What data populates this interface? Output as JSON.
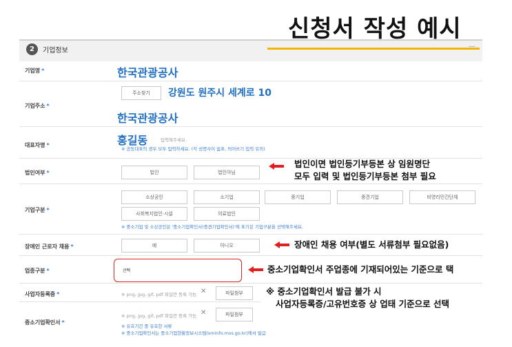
{
  "title": "신청서 작성 예시",
  "section": {
    "number": "2",
    "label": "기업정보",
    "dash": "—"
  },
  "rows": {
    "company_name": {
      "label": "기업명",
      "req": "*",
      "value": "한국관광공사"
    },
    "address": {
      "label": "기업주소",
      "req": "*",
      "search_button": "주소찾기",
      "value": "강원도 원주시 세계로 10"
    },
    "address_org": {
      "value": "한국관광공사"
    },
    "ceo": {
      "label": "대표자명",
      "req": "*",
      "value": "홍길동",
      "placeholder": "입력해주세요.",
      "hint": "※ 공동대표의 경우 모두 입력하세요. (각 성명사이 쉼표, 띄어쓰기 입력 유의)"
    },
    "corp": {
      "label": "법인여부",
      "req": "*",
      "options": [
        "법인",
        "법인아님"
      ]
    },
    "type": {
      "label": "기업구분",
      "req": "*",
      "options_row1": [
        "소상공인",
        "소기업",
        "중기업",
        "중견기업",
        "비영리민간단체"
      ],
      "options_row2": [
        "사회복지법인·시설",
        "의료법인"
      ],
      "hint": "※ 중소기업 및 소상공인은 '중소기업확인서(중견기업확인서)'에 표기된 기업구분을 선택해주세요."
    },
    "disabled": {
      "label": "장애인 근로자 채용",
      "req": "*",
      "options": [
        "예",
        "아니오"
      ]
    },
    "industry": {
      "label": "업종구분",
      "req": "*",
      "select_value": "선택"
    },
    "bizreg": {
      "label": "사업자등록증",
      "req": "*",
      "file_hint": "※ png, jpg, gif, pdf 파일만 등록 가능",
      "button": "파일첨부"
    },
    "sme": {
      "label": "중소기업확인서",
      "req": "*",
      "file_hint": "※ png, jpg, gif, pdf 파일만 등록 가능",
      "button": "파일첨부",
      "hint1": "※ 유효기간 중 유효한 서류",
      "hint2": "※ 중소기업확인서는 중소기업현황정보시스템(sminfo.mss.go.kr)에서 발급"
    }
  },
  "annotations": {
    "corp_line1": "법인이면 법인등기부등본 상 임원명단",
    "corp_line2": "모두 입력 및 법인등기부등본 첨부 필요",
    "disabled": "장애인 채용 여부(별도 서류첨부 필요없음)",
    "industry": "중소기업확인서 주업종에 기재되어있는 기준으로 택",
    "note_line1": "※ 중소기업확인서 발급 불가 시",
    "note_line2": "사업자등록증/고유번호증 상 업태 기준으로 선택"
  },
  "colors": {
    "blue_text": "#1f6fc2",
    "red_arrow": "#e02020",
    "accent_line": "#f5b400"
  },
  "icons": {
    "remove": "close-icon",
    "arrow": "left-arrow-icon"
  }
}
